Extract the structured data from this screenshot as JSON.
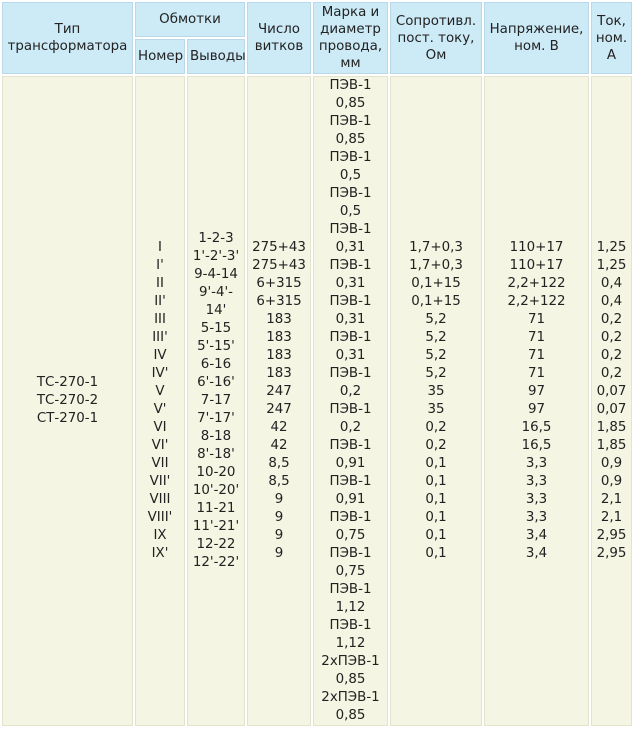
{
  "headers": {
    "type": [
      "Тип",
      "трансформатора"
    ],
    "windings": "Обмотки",
    "number": "Номер",
    "terminals": "Выводы",
    "turns": [
      "Число",
      "витков"
    ],
    "wire": [
      "Марка и",
      "диаметр",
      "провода,",
      "мм"
    ],
    "resistance": [
      "Сопротивл.",
      "пост. току,",
      "Ом"
    ],
    "voltage": [
      "Напряжение,",
      "ном. В"
    ],
    "current": [
      "Ток,",
      "ном.",
      "А"
    ]
  },
  "transformer_types": [
    "ТС-270-1",
    "ТС-270-2",
    "СТ-270-1"
  ],
  "numbers": [
    "I",
    "I'",
    "II",
    "II'",
    "III",
    "III'",
    "IV",
    "IV'",
    "V",
    "V'",
    "VI",
    "VI'",
    "VII",
    "VII'",
    "VIII",
    "VIII'",
    "IX",
    "IX'"
  ],
  "terminals": [
    "1-2-3",
    "1'-2'-3'",
    "9-4-14",
    "9'-4'-",
    "14'",
    "5-15",
    "5'-15'",
    "6-16",
    "6'-16'",
    "7-17",
    "7'-17'",
    "8-18",
    "8'-18'",
    "10-20",
    "10'-20'",
    "11-21",
    "11'-21'",
    "12-22",
    "12'-22'"
  ],
  "turns": [
    "275+43",
    "275+43",
    "6+315",
    "6+315",
    "183",
    "183",
    "183",
    "183",
    "247",
    "247",
    "42",
    "42",
    "8,5",
    "8,5",
    "9",
    "9",
    "9",
    "9"
  ],
  "wire": [
    "ПЭВ-1",
    "0,85",
    "ПЭВ-1",
    "0,85",
    "ПЭВ-1",
    "0,5",
    "ПЭВ-1",
    "0,5",
    "ПЭВ-1",
    "0,31",
    "ПЭВ-1",
    "0,31",
    "ПЭВ-1",
    "0,31",
    "ПЭВ-1",
    "0,31",
    "ПЭВ-1",
    "0,2",
    "ПЭВ-1",
    "0,2",
    "ПЭВ-1",
    "0,91",
    "ПЭВ-1",
    "0,91",
    "ПЭВ-1",
    "0,75",
    "ПЭВ-1",
    "0,75",
    "ПЭВ-1",
    "1,12",
    "ПЭВ-1",
    "1,12",
    "2хПЭВ-1",
    "0,85",
    "2хПЭВ-1",
    "0,85"
  ],
  "resistance": [
    "1,7+0,3",
    "1,7+0,3",
    "0,1+15",
    "0,1+15",
    "5,2",
    "5,2",
    "5,2",
    "5,2",
    "35",
    "35",
    "0,2",
    "0,2",
    "0,1",
    "0,1",
    "0,1",
    "0,1",
    "0,1",
    "0,1"
  ],
  "voltage": [
    "110+17",
    "110+17",
    "2,2+122",
    "2,2+122",
    "71",
    "71",
    "71",
    "71",
    "97",
    "97",
    "16,5",
    "16,5",
    "3,3",
    "3,3",
    "3,3",
    "3,3",
    "3,4",
    "3,4"
  ],
  "current": [
    "1,25",
    "1,25",
    "0,4",
    "0,4",
    "0,2",
    "0,2",
    "0,2",
    "0,2",
    "0,07",
    "0,07",
    "1,85",
    "1,85",
    "0,9",
    "0,9",
    "2,1",
    "2,1",
    "2,95",
    "2,95"
  ]
}
